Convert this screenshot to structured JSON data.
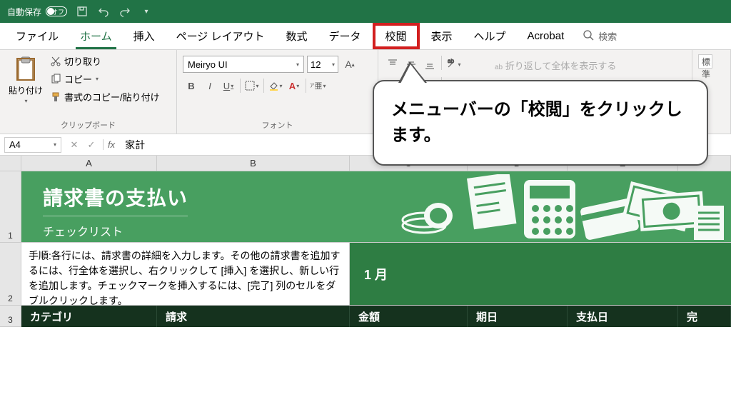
{
  "titlebar": {
    "autosave_label": "自動保存",
    "autosave_state": "オフ"
  },
  "tabs": {
    "file": "ファイル",
    "home": "ホーム",
    "insert": "挿入",
    "page_layout": "ページ レイアウト",
    "formulas": "数式",
    "data": "データ",
    "review": "校閲",
    "view": "表示",
    "help": "ヘルプ",
    "acrobat": "Acrobat",
    "search": "検索"
  },
  "ribbon": {
    "clipboard": {
      "paste": "貼り付け",
      "cut": "切り取り",
      "copy": "コピー",
      "format_painter": "書式のコピー/貼り付け",
      "group_label": "クリップボード"
    },
    "font": {
      "name": "Meiryo UI",
      "size": "12",
      "bold": "B",
      "italic": "I",
      "underline": "U",
      "group_label": "フォント"
    },
    "alignment": {
      "wrap_text": "折り返して全体を表示する"
    },
    "number_group": {
      "standard": "標準"
    }
  },
  "formula_bar": {
    "name_box": "A4",
    "fx": "fx",
    "value": "家計"
  },
  "columns": {
    "A": "A",
    "B": "B",
    "C": "C",
    "D": "D",
    "E": "E"
  },
  "rows": {
    "r1": "1",
    "r2": "2",
    "r3": "3"
  },
  "sheet": {
    "banner_title": "請求書の支払い",
    "banner_sub": "チェックリスト",
    "instructions": "手順:各行には、請求書の詳細を入力します。その他の請求書を追加するには、行全体を選択し、右クリックして [挿入] を選択し、新しい行を追加します。チェックマークを挿入するには、[完了] 列のセルをダブルクリックします。",
    "month": "1 月",
    "headers": {
      "category": "カテゴリ",
      "bill": "請求",
      "amount": "金額",
      "due": "期日",
      "paid": "支払日",
      "done": "完"
    }
  },
  "callout": {
    "text": "メニューバーの「校閲」をクリックします。"
  }
}
